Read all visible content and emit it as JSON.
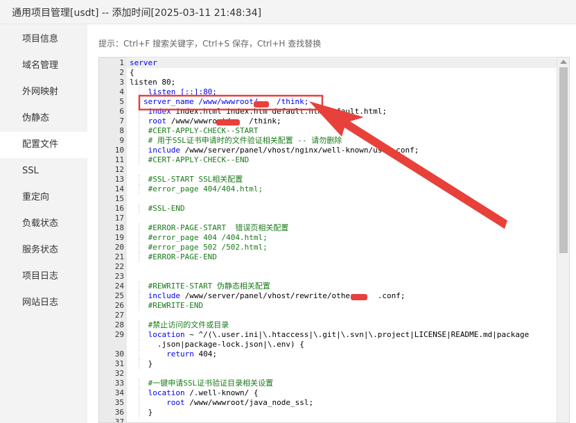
{
  "window": {
    "title": "通用项目管理[usdt] -- 添加时间[2025-03-11 21:48:34]"
  },
  "sidebar": {
    "items": [
      {
        "label": "项目信息"
      },
      {
        "label": "域名管理"
      },
      {
        "label": "外网映射"
      },
      {
        "label": "伪静态"
      },
      {
        "label": "配置文件",
        "active": true
      },
      {
        "label": "SSL"
      },
      {
        "label": "重定向"
      },
      {
        "label": "负载状态"
      },
      {
        "label": "服务状态"
      },
      {
        "label": "项目日志"
      },
      {
        "label": "网站日志"
      }
    ]
  },
  "editor": {
    "hint": "提示：Ctrl+F 搜索关键字，Ctrl+S 保存，Ctrl+H 查找替换",
    "lines": [
      {
        "n": "1",
        "indent": 0,
        "text": "server",
        "style": "kw"
      },
      {
        "n": "2",
        "indent": 0,
        "text": "{",
        "style": "plain"
      },
      {
        "n": "3",
        "indent": 0,
        "text": "listen 80;",
        "style": "plain"
      },
      {
        "n": "4",
        "indent": 4,
        "text": "listen [::]:80;",
        "style": "kw"
      },
      {
        "n": "5",
        "indent": 3,
        "text": "server_name /www/wwwroot/    /think;",
        "style": "kw"
      },
      {
        "n": "6",
        "indent": 4,
        "text": "index index.html index.htm default.htm default.html;",
        "style": "kw_mixed"
      },
      {
        "n": "7",
        "indent": 4,
        "text": "root /www/wwwroot/    /think;",
        "style": "kw_mixed"
      },
      {
        "n": "8",
        "indent": 4,
        "text": "#CERT-APPLY-CHECK--START",
        "style": "cm"
      },
      {
        "n": "9",
        "indent": 4,
        "text": "# 用于SSL证书申请时的文件验证相关配置 -- 请勿删除",
        "style": "cm"
      },
      {
        "n": "10",
        "indent": 4,
        "text": "include /www/server/panel/vhost/nginx/well-known/usdt.conf;",
        "style": "kw_mixed"
      },
      {
        "n": "11",
        "indent": 4,
        "text": "#CERT-APPLY-CHECK--END",
        "style": "cm"
      },
      {
        "n": "12",
        "indent": 0,
        "text": "",
        "style": "plain"
      },
      {
        "n": "13",
        "indent": 4,
        "text": "#SSL-START SSL相关配置",
        "style": "cm"
      },
      {
        "n": "14",
        "indent": 4,
        "text": "#error_page 404/404.html;",
        "style": "cm"
      },
      {
        "n": "15",
        "indent": 0,
        "text": "",
        "style": "plain"
      },
      {
        "n": "16",
        "indent": 4,
        "text": "#SSL-END",
        "style": "cm"
      },
      {
        "n": "17",
        "indent": 0,
        "text": "",
        "style": "plain"
      },
      {
        "n": "18",
        "indent": 4,
        "text": "#ERROR-PAGE-START  错误页相关配置",
        "style": "cm"
      },
      {
        "n": "19",
        "indent": 4,
        "text": "#error_page 404 /404.html;",
        "style": "cm"
      },
      {
        "n": "20",
        "indent": 4,
        "text": "#error_page 502 /502.html;",
        "style": "cm"
      },
      {
        "n": "21",
        "indent": 4,
        "text": "#ERROR-PAGE-END",
        "style": "cm"
      },
      {
        "n": "22",
        "indent": 0,
        "text": "",
        "style": "plain"
      },
      {
        "n": "23",
        "indent": 0,
        "text": "",
        "style": "plain"
      },
      {
        "n": "24",
        "indent": 4,
        "text": "#REWRITE-START 伪静态相关配置",
        "style": "cm"
      },
      {
        "n": "25",
        "indent": 4,
        "text": "include /www/server/panel/vhost/rewrite/other_    .conf;",
        "style": "kw_mixed"
      },
      {
        "n": "26",
        "indent": 4,
        "text": "#REWRITE-END",
        "style": "cm"
      },
      {
        "n": "27",
        "indent": 0,
        "text": "",
        "style": "plain"
      },
      {
        "n": "28",
        "indent": 4,
        "text": "#禁止访问的文件或目录",
        "style": "cm"
      },
      {
        "n": "29",
        "indent": 4,
        "text": "location ~ ^/(\\.user.ini|\\.htaccess|\\.git|\\.svn|\\.project|LICENSE|README.md|package",
        "style": "kw_mixed"
      },
      {
        "n": "",
        "indent": 6,
        "text": ".json|package-lock.json|\\.env) {",
        "style": "plain"
      },
      {
        "n": "30",
        "indent": 8,
        "text": "return 404;",
        "style": "kw_mixed"
      },
      {
        "n": "31",
        "indent": 4,
        "text": "}",
        "style": "plain"
      },
      {
        "n": "32",
        "indent": 0,
        "text": "",
        "style": "plain"
      },
      {
        "n": "33",
        "indent": 4,
        "text": "#一键申请SSL证书验证目录相关设置",
        "style": "cm"
      },
      {
        "n": "34",
        "indent": 4,
        "text": "location /.well-known/ {",
        "style": "kw_mixed"
      },
      {
        "n": "35",
        "indent": 8,
        "text": "root /www/wwwroot/java_node_ssl;",
        "style": "kw_mixed"
      },
      {
        "n": "36",
        "indent": 4,
        "text": "}",
        "style": "plain"
      },
      {
        "n": "37",
        "indent": 0,
        "text": "",
        "style": "plain"
      }
    ]
  },
  "annotation": {
    "color": "#e8403a"
  }
}
